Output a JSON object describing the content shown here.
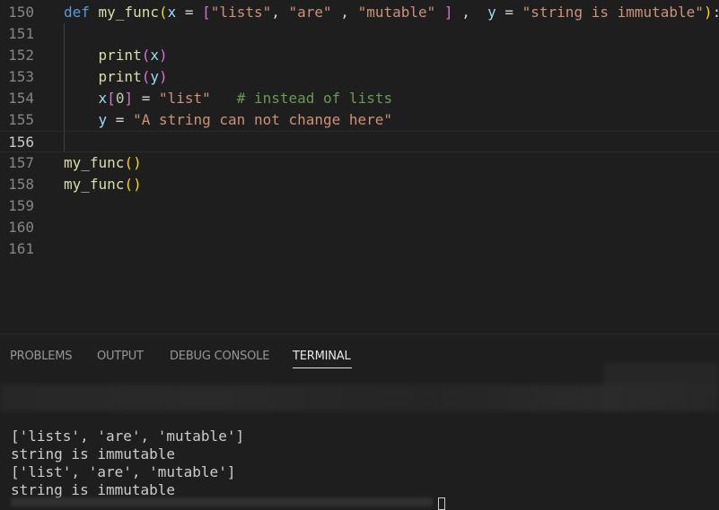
{
  "editor": {
    "lines": [
      {
        "num": "150",
        "tokens": [
          {
            "t": "def ",
            "c": "k"
          },
          {
            "t": "my_func",
            "c": "f"
          },
          {
            "t": "(",
            "c": "b1"
          },
          {
            "t": "x",
            "c": "v"
          },
          {
            "t": " = ",
            "c": "op"
          },
          {
            "t": "[",
            "c": "b2"
          },
          {
            "t": "\"lists\"",
            "c": "s"
          },
          {
            "t": ", ",
            "c": "op"
          },
          {
            "t": "\"are\"",
            "c": "s"
          },
          {
            "t": " , ",
            "c": "op"
          },
          {
            "t": "\"mutable\"",
            "c": "s"
          },
          {
            "t": " ",
            "c": "op"
          },
          {
            "t": "]",
            "c": "b2"
          },
          {
            "t": " ,  ",
            "c": "op"
          },
          {
            "t": "y",
            "c": "v"
          },
          {
            "t": " = ",
            "c": "op"
          },
          {
            "t": "\"string is immutable\"",
            "c": "s"
          },
          {
            "t": ")",
            "c": "b1"
          },
          {
            "t": ":",
            "c": "op"
          }
        ]
      },
      {
        "num": "151",
        "tokens": []
      },
      {
        "num": "152",
        "tokens": [
          {
            "t": "    ",
            "c": "op"
          },
          {
            "t": "print",
            "c": "f"
          },
          {
            "t": "(",
            "c": "b2"
          },
          {
            "t": "x",
            "c": "v"
          },
          {
            "t": ")",
            "c": "b2"
          }
        ]
      },
      {
        "num": "153",
        "tokens": [
          {
            "t": "    ",
            "c": "op"
          },
          {
            "t": "print",
            "c": "f"
          },
          {
            "t": "(",
            "c": "b2"
          },
          {
            "t": "y",
            "c": "v"
          },
          {
            "t": ")",
            "c": "b2"
          }
        ]
      },
      {
        "num": "154",
        "tokens": [
          {
            "t": "    ",
            "c": "op"
          },
          {
            "t": "x",
            "c": "v"
          },
          {
            "t": "[",
            "c": "b2"
          },
          {
            "t": "0",
            "c": "n"
          },
          {
            "t": "]",
            "c": "b2"
          },
          {
            "t": " = ",
            "c": "op"
          },
          {
            "t": "\"list\"",
            "c": "s"
          },
          {
            "t": "   ",
            "c": "op"
          },
          {
            "t": "# instead of lists",
            "c": "c"
          }
        ]
      },
      {
        "num": "155",
        "tokens": [
          {
            "t": "    ",
            "c": "op"
          },
          {
            "t": "y",
            "c": "v"
          },
          {
            "t": " = ",
            "c": "op"
          },
          {
            "t": "\"A string can not change here\"",
            "c": "s"
          }
        ]
      },
      {
        "num": "156",
        "tokens": [],
        "active": true
      },
      {
        "num": "157",
        "tokens": [
          {
            "t": "my_func",
            "c": "f"
          },
          {
            "t": "()",
            "c": "b1"
          }
        ]
      },
      {
        "num": "158",
        "tokens": [
          {
            "t": "my_func",
            "c": "f"
          },
          {
            "t": "()",
            "c": "b1"
          }
        ]
      },
      {
        "num": "159",
        "tokens": []
      },
      {
        "num": "160",
        "tokens": []
      },
      {
        "num": "161",
        "tokens": []
      }
    ]
  },
  "panel": {
    "tabs": [
      {
        "label": "PROBLEMS",
        "active": false
      },
      {
        "label": "OUTPUT",
        "active": false
      },
      {
        "label": "DEBUG CONSOLE",
        "active": false
      },
      {
        "label": "TERMINAL",
        "active": true
      }
    ]
  },
  "terminal": {
    "lines": [
      "['lists', 'are', 'mutable']",
      "string is immutable",
      "['list', 'are', 'mutable']",
      "string is immutable"
    ]
  },
  "colors": {
    "background": "#1e1e1e",
    "keyword": "#569cd6",
    "function": "#dcdcaa",
    "variable": "#9cdcfe",
    "string": "#ce9178",
    "comment": "#6a9955"
  }
}
